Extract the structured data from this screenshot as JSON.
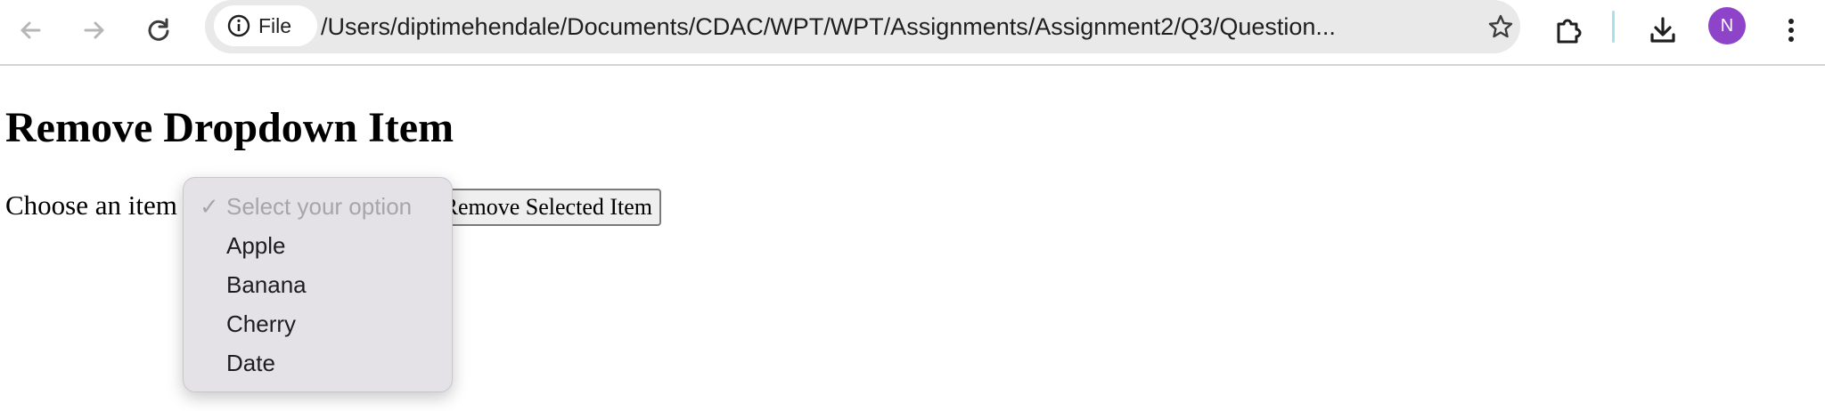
{
  "browser": {
    "back_icon": "arrow-left-icon",
    "forward_icon": "arrow-right-icon",
    "reload_icon": "reload-icon",
    "site_info_label": "File",
    "url": "/Users/diptimehendale/Documents/CDAC/WPT/WPT/Assignments/Assignment2/Q3/Question...",
    "avatar_initial": "N",
    "avatar_color": "#8e44c8"
  },
  "page": {
    "title": "Remove Dropdown Item",
    "choose_label": "Choose an item",
    "remove_button_label": "Remove Selected Item"
  },
  "dropdown": {
    "selected": "Select your option",
    "options": [
      "Apple",
      "Banana",
      "Cherry",
      "Date"
    ]
  }
}
